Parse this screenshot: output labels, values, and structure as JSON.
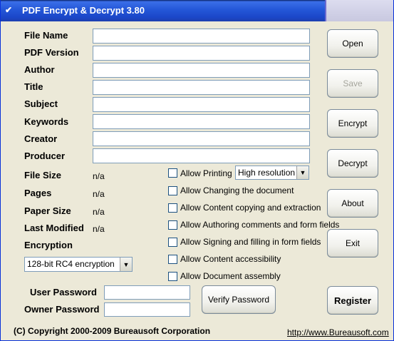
{
  "window": {
    "title": "PDF Encrypt & Decrypt 3.80"
  },
  "fields": [
    {
      "label": "File Name",
      "value": ""
    },
    {
      "label": "PDF Version",
      "value": ""
    },
    {
      "label": "Author",
      "value": ""
    },
    {
      "label": "Title",
      "value": ""
    },
    {
      "label": "Subject",
      "value": ""
    },
    {
      "label": "Keywords",
      "value": ""
    },
    {
      "label": "Creator",
      "value": ""
    },
    {
      "label": "Producer",
      "value": ""
    }
  ],
  "info": [
    {
      "label": "File Size",
      "value": "n/a"
    },
    {
      "label": "Pages",
      "value": "n/a"
    },
    {
      "label": "Paper Size",
      "value": "n/a"
    },
    {
      "label": "Last Modified",
      "value": "n/a"
    }
  ],
  "encryption": {
    "label": "Encryption",
    "selected": "128-bit RC4 encryption"
  },
  "permissions": [
    "Allow Printing",
    "Allow Changing the document",
    "Allow Content copying and extraction",
    "Allow Authoring comments and form fields",
    "Allow Signing and filling in form fields",
    "Allow Content accessibility",
    "Allow Document assembly"
  ],
  "print_quality": "High resolution",
  "passwords": {
    "user_label": "User Password",
    "owner_label": "Owner Password"
  },
  "buttons": {
    "open": "Open",
    "save": "Save",
    "encrypt": "Encrypt",
    "decrypt": "Decrypt",
    "about": "About",
    "exit": "Exit",
    "verify": "Verify Password",
    "register": "Register"
  },
  "footer": {
    "copyright": "(C) Copyright 2000-2009 Bureausoft Corporation",
    "url": "http://www.Bureausoft.com"
  }
}
